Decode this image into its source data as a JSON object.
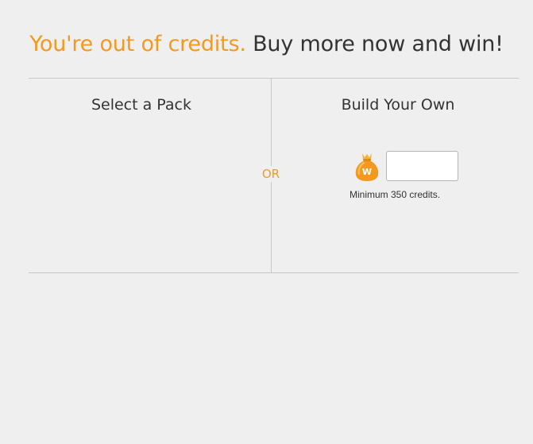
{
  "headline": {
    "lead": "You're out of credits.",
    "tail": "Buy more now and win!"
  },
  "left_section": {
    "title": "Select a Pack"
  },
  "separator": {
    "label": "OR"
  },
  "right_section": {
    "title": "Build Your Own",
    "input_value": "",
    "coin_icon": "money-bag-icon",
    "coin_letter": "W",
    "note": "Minimum 350 credits."
  },
  "colors": {
    "accent": "#f39a1e",
    "text": "#333333",
    "background": "#efefef",
    "rule": "#c8c8c8"
  }
}
